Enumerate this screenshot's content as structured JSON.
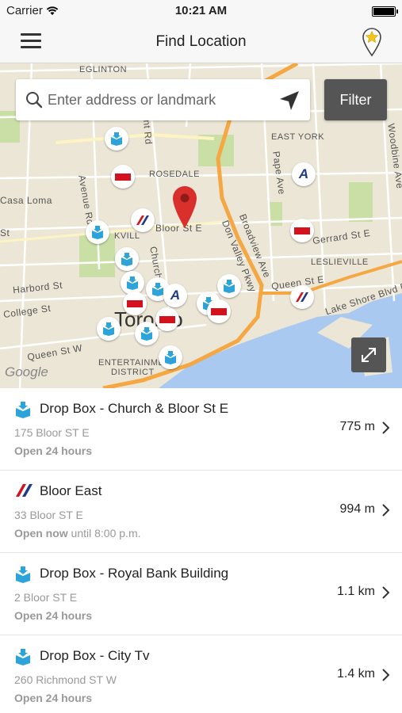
{
  "status_bar": {
    "carrier": "Carrier",
    "time": "10:21 AM"
  },
  "nav": {
    "title": "Find Location",
    "menu_icon": "hamburger-menu-icon",
    "favorite_icon": "star-location-pin-icon"
  },
  "map": {
    "search": {
      "placeholder": "Enter address or landmark",
      "value": ""
    },
    "filter_label": "Filter",
    "google_logo": "Google",
    "labels": {
      "eglinton": "EGLINTON",
      "east_york": "EAST YORK",
      "rosedale": "ROSEDALE",
      "casa_loma": "Casa Loma",
      "bloor_st_e": "Bloor St E",
      "avenue_rd": "Avenue Rd",
      "church": "Church",
      "broadview": "Broadview Ave",
      "don_valley": "Don Valley Pkwy",
      "pape": "Pape Ave",
      "woodbine": "Woodbine Ave",
      "gerrard": "Gerrard St E",
      "leslieville": "LESLIEVILLE",
      "queen_st_e": "Queen St E",
      "lake_shore": "Lake Shore Blvd E",
      "harbord": "Harbord St",
      "college": "College St",
      "queen_st_w": "Queen St W",
      "entertainment": "ENTERTAINMENT",
      "district": "DISTRICT",
      "toronto": "Toronto",
      "ksville": "KVILL",
      "pleasant": "asant Rd",
      "st_left": "St"
    },
    "colors": {
      "water": "#a9c9f0",
      "park": "#c9dfa6",
      "highway": "#f4a742",
      "road": "#ffffff"
    }
  },
  "locations": [
    {
      "icon": "drop-box-icon",
      "name": "Drop Box - Church & Bloor St E",
      "address": "175 Bloor ST E",
      "hours_bold": "Open 24 hours",
      "hours_rest": "",
      "distance": "775 m"
    },
    {
      "icon": "canada-post-icon",
      "name": "Bloor East",
      "address": "33 Bloor ST E",
      "hours_bold": "Open now",
      "hours_rest": " until 8:00 p.m.",
      "distance": "994 m"
    },
    {
      "icon": "drop-box-icon",
      "name": "Drop Box - Royal Bank Building",
      "address": "2 Bloor ST E",
      "hours_bold": "Open 24 hours",
      "hours_rest": "",
      "distance": "1.1 km"
    },
    {
      "icon": "drop-box-icon",
      "name": "Drop Box - City Tv",
      "address": "260 Richmond ST W",
      "hours_bold": "Open 24 hours",
      "hours_rest": "",
      "distance": "1.4 km"
    }
  ]
}
